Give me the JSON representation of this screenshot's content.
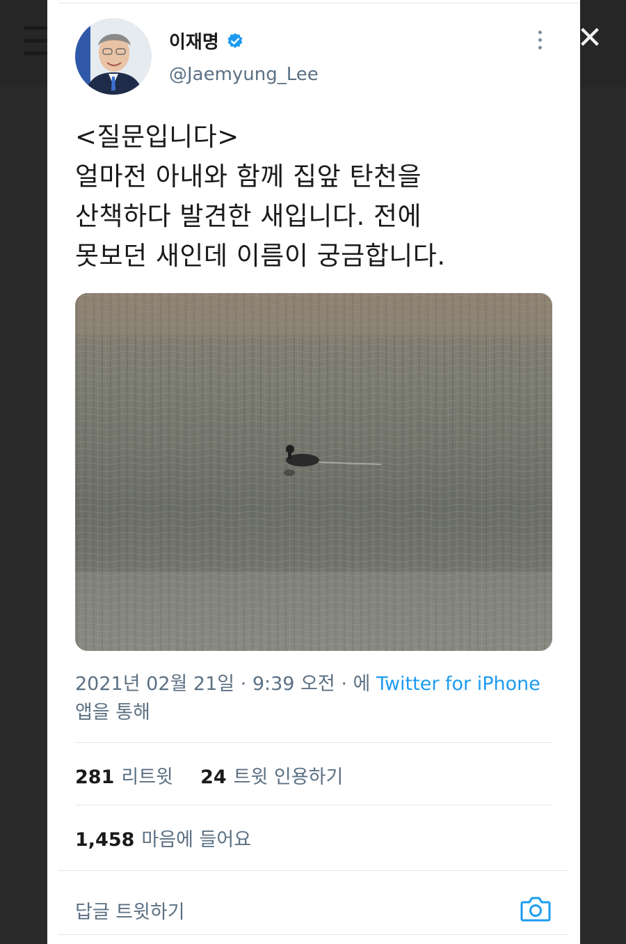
{
  "header": {
    "close_glyph": "✕"
  },
  "tweet": {
    "author_name": "이재명",
    "handle": "@Jaemyung_Lee",
    "text_lines": [
      "<질문입니다>",
      "얼마전 아내와 함께 집앞 탄천을",
      "산책하다 발견한 새입니다. 전에",
      "못보던 새인데 이름이 궁금합니다."
    ],
    "timestamp": "2021년 02월 21일 · 9:39 오전 · 에 ",
    "source": "Twitter for iPhone",
    "source_suffix": "앱을 통해",
    "retweets_count": "281",
    "retweets_label": "리트윗",
    "quotes_count": "24",
    "quotes_label": "트윗 인용하기",
    "likes_count": "1,458",
    "likes_label": "마음에 들어요"
  },
  "reply": {
    "placeholder": "답글 트윗하기"
  },
  "icons": {
    "menu": "menu-icon",
    "close": "close-icon",
    "verified": "verified-badge-icon",
    "more": "more-vertical-icon",
    "camera": "camera-icon"
  },
  "colors": {
    "accent": "#1d9bf0",
    "secondary_text": "#5b7083",
    "primary_text": "#1a1a1a",
    "background": "#2a2a2a",
    "card": "#ffffff"
  }
}
